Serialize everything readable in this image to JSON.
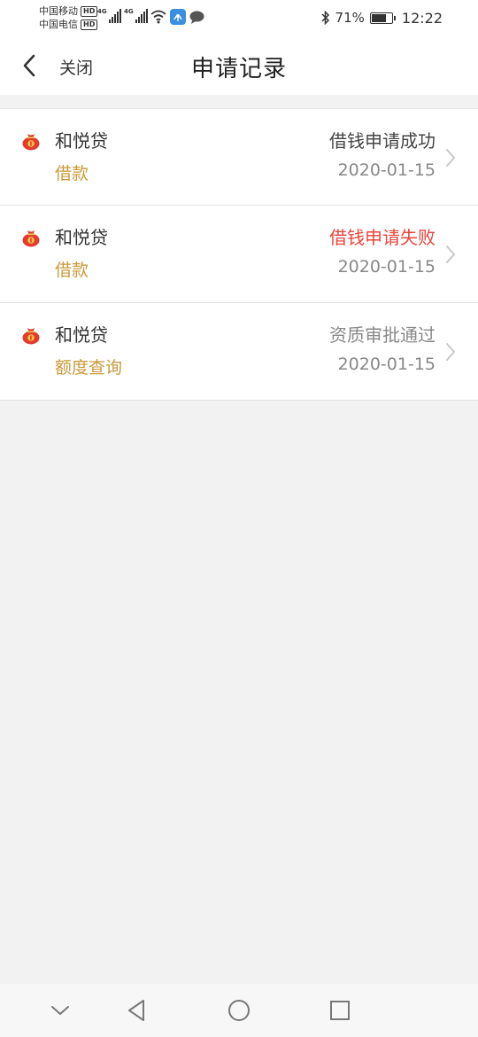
{
  "status_bar": {
    "carrier1": "中国移动",
    "carrier2": "中国电信",
    "hd": "HD",
    "network": "4G",
    "battery_percent": "71%",
    "battery_level": 0.71,
    "time": "12:22"
  },
  "header": {
    "close_label": "关闭",
    "title": "申请记录"
  },
  "records": [
    {
      "lender": "和悦贷",
      "type": "借款",
      "status": "借钱申请成功",
      "status_color": "#444444",
      "date": "2020-01-15"
    },
    {
      "lender": "和悦贷",
      "type": "借款",
      "status": "借钱申请失败",
      "status_color": "#e8453c",
      "date": "2020-01-15"
    },
    {
      "lender": "和悦贷",
      "type": "额度查询",
      "status": "资质审批通过",
      "status_color": "#888888",
      "date": "2020-01-15"
    }
  ],
  "colors": {
    "type_accent": "#c99a3a",
    "background": "#f2f2f2"
  },
  "icons": {
    "lender_icon": "money-bag-icon",
    "row_arrow": "chevron-right-icon",
    "nav": [
      "chevron-down-icon",
      "back-triangle-icon",
      "home-circle-icon",
      "recents-square-icon"
    ]
  }
}
